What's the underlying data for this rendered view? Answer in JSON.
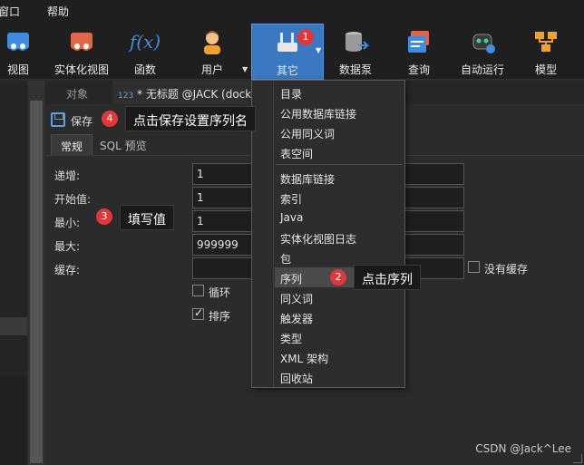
{
  "menubar": {
    "items": [
      "窗口",
      "帮助"
    ]
  },
  "toolbar": {
    "items": [
      {
        "label": "视图",
        "icon": "view-icon"
      },
      {
        "label": "实体化视图",
        "icon": "materialized-view-icon"
      },
      {
        "label": "函数",
        "icon": "function-icon"
      },
      {
        "label": "用户",
        "icon": "user-icon"
      },
      {
        "label": "其它",
        "icon": "tools-icon"
      },
      {
        "label": "数据泵",
        "icon": "data-pump-icon"
      },
      {
        "label": "查询",
        "icon": "query-icon"
      },
      {
        "label": "自动运行",
        "icon": "robot-icon"
      },
      {
        "label": "模型",
        "icon": "model-icon"
      }
    ],
    "function_glyph": "f(x)"
  },
  "tabs": {
    "objects": "对象",
    "query_prefix": "123",
    "query_tab": "* 无标题 @JACK (docke"
  },
  "savebar": {
    "save_label": "保存"
  },
  "subtabs": {
    "general": "常规",
    "sql_preview": "SQL 预览"
  },
  "form": {
    "increment_label": "递增:",
    "increment_value": "1",
    "start_label": "开始值:",
    "start_value": "1",
    "min_label": "最小:",
    "min_value": "1",
    "max_label": "最大:",
    "max_value": "999999",
    "cache_label": "缓存:",
    "cache_value": "",
    "cycle_label": "循环",
    "cycle_checked": false,
    "order_label": "排序",
    "order_checked": true,
    "no_cache_label": "没有缓存",
    "no_cache_checked": false
  },
  "menu": {
    "items": [
      "目录",
      "公用数据库链接",
      "公用同义词",
      "表空间",
      "数据库链接",
      "索引",
      "Java",
      "实体化视图日志",
      "包",
      "序列",
      "同义词",
      "触发器",
      "类型",
      "XML 架构",
      "回收站"
    ],
    "highlighted": "序列"
  },
  "callouts": {
    "c1": {
      "num": "1"
    },
    "c2": {
      "num": "2",
      "text": "点击序列"
    },
    "c3": {
      "num": "3",
      "text": "填写值"
    },
    "c4": {
      "num": "4",
      "text": "点击保存设置序列名"
    }
  },
  "watermark": "CSDN @Jack^Lee",
  "colors": {
    "accent": "#3a78c2",
    "badge": "#e0383a",
    "background": "#2b2b2b"
  }
}
